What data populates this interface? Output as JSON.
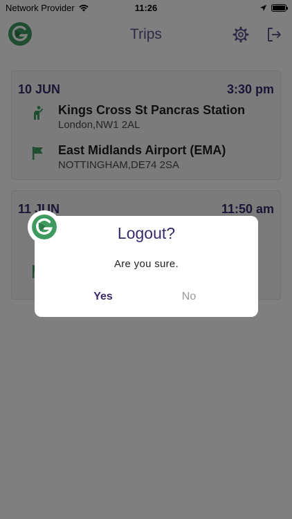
{
  "status_bar": {
    "carrier": "Network Provider",
    "time": "11:26"
  },
  "header": {
    "title": "Trips"
  },
  "trips": [
    {
      "date": "10 JUN",
      "time": "3:30 pm",
      "pickup": {
        "name": "Kings Cross St Pancras Station",
        "address": "London,NW1 2AL"
      },
      "dropoff": {
        "name": "East Midlands Airport (EMA)",
        "address": "NOTTINGHAM,DE74 2SA"
      }
    },
    {
      "date": "11 JUN",
      "time": "11:50 am"
    }
  ],
  "dialog": {
    "title": "Logout?",
    "message": "Are you sure.",
    "yes_label": "Yes",
    "no_label": "No"
  },
  "colors": {
    "brand_green": "#3f9a5f",
    "accent_purple": "#3a2a6c",
    "header_title": "#5e4f8c",
    "overlay": "rgba(0,0,0,0.5)"
  },
  "icons": {
    "pickup": "person-waving-icon",
    "dropoff": "flag-icon",
    "settings": "gear-icon",
    "logout": "logout-icon",
    "logo": "app-logo-icon"
  }
}
